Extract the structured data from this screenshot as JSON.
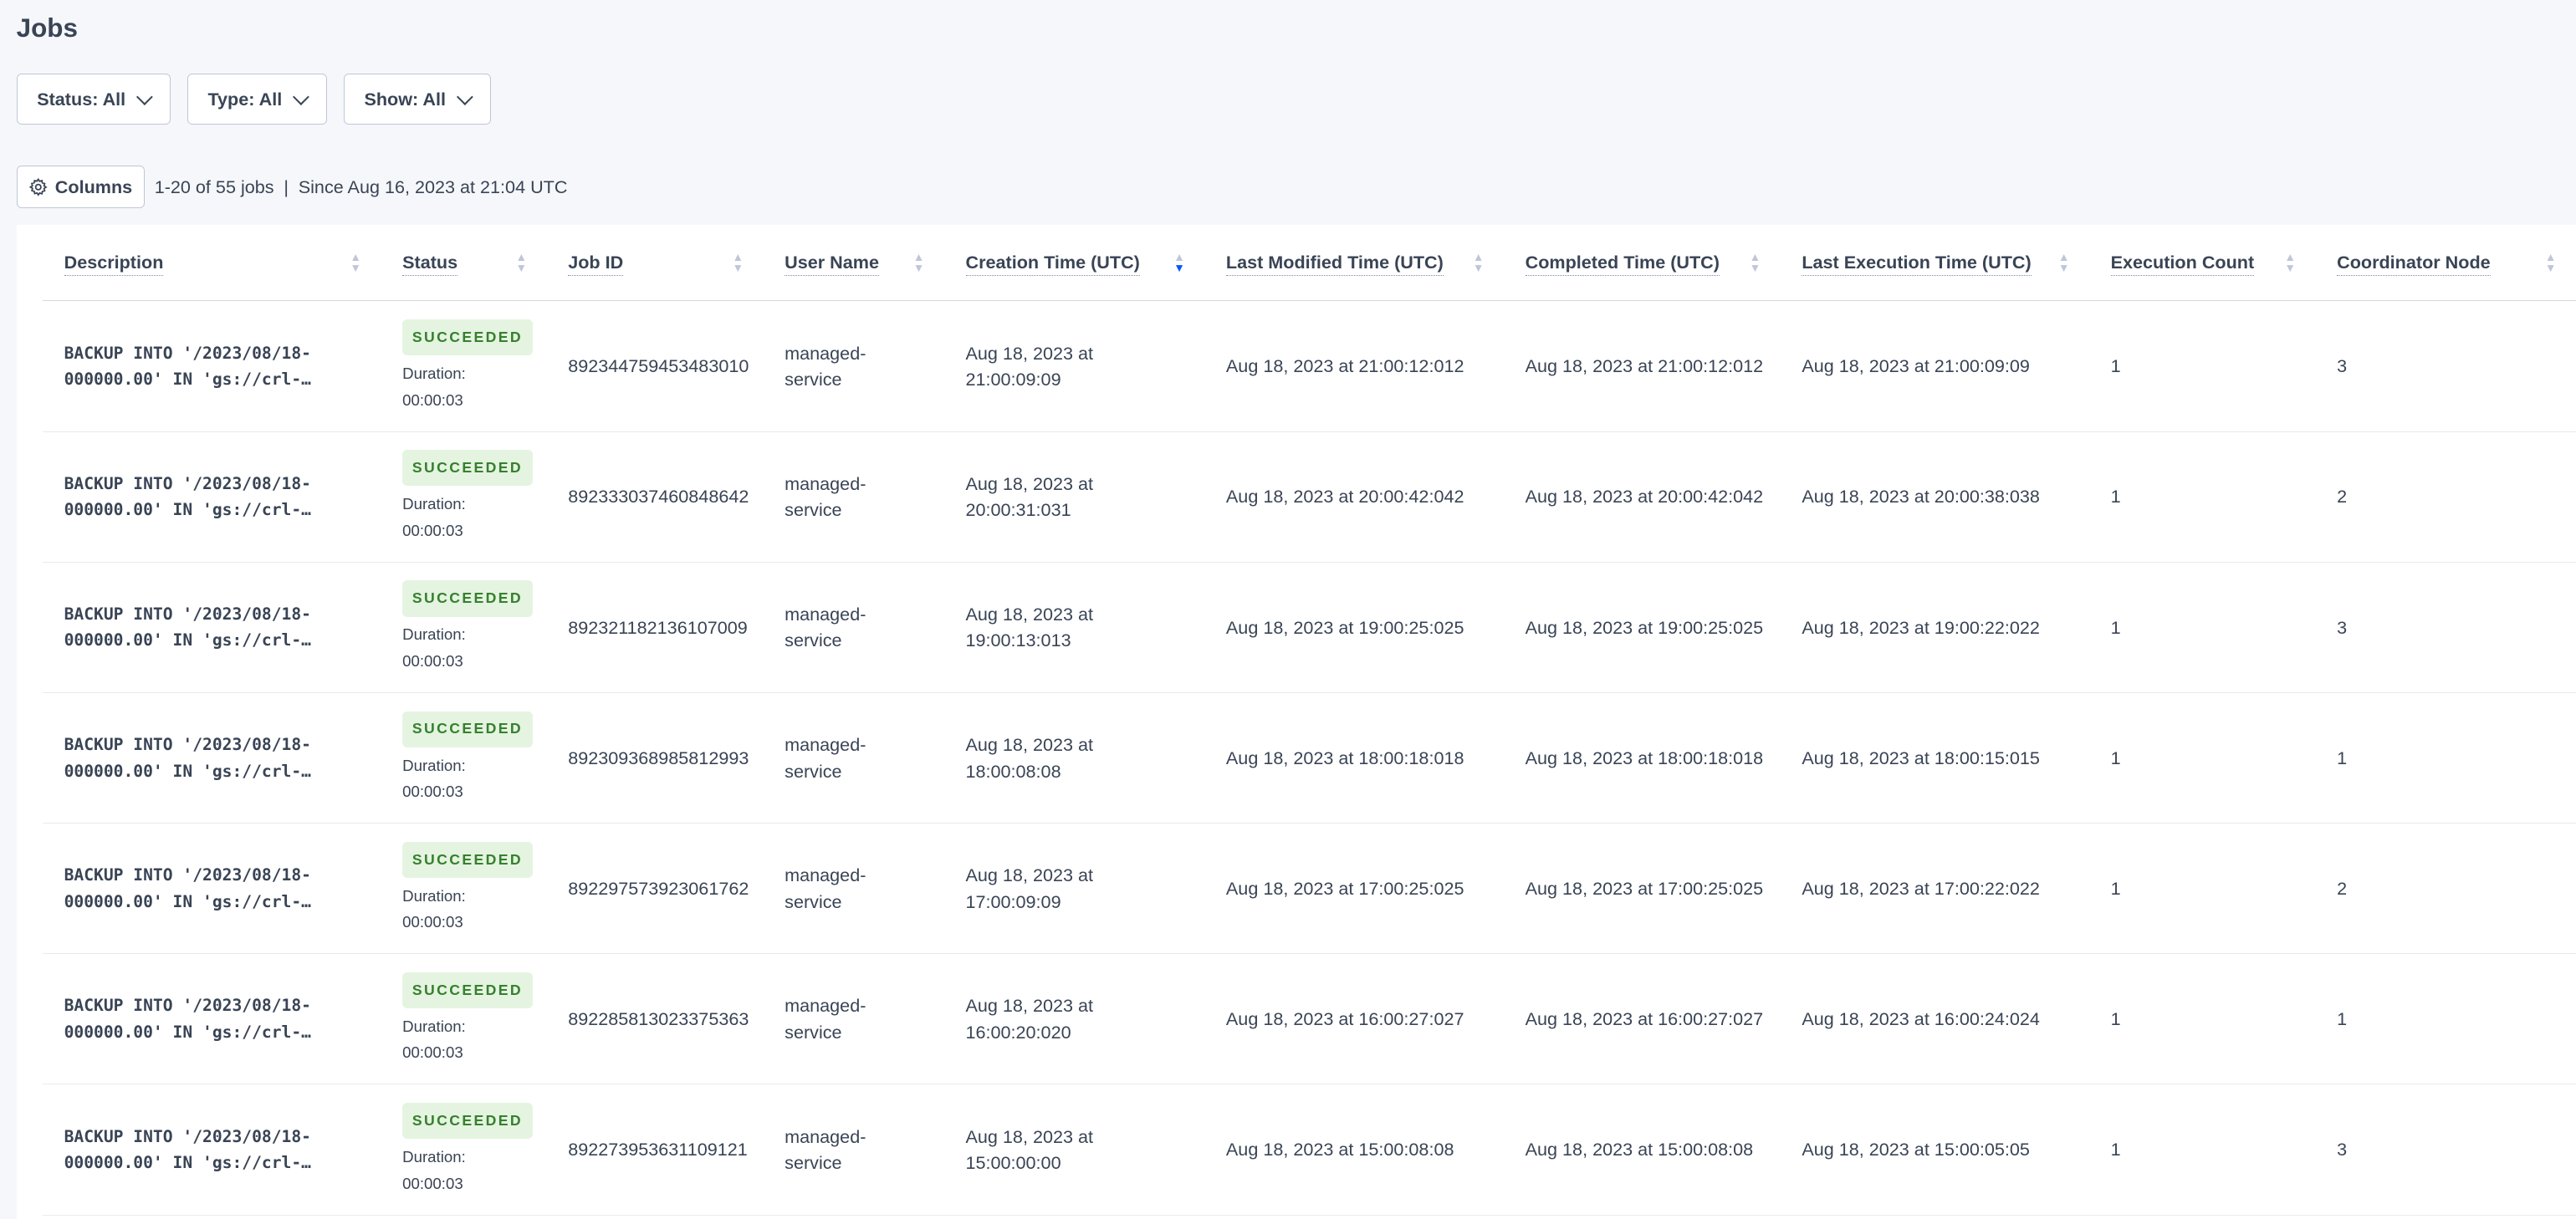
{
  "page": {
    "title": "Jobs"
  },
  "filters": [
    {
      "label": "Status: All"
    },
    {
      "label": "Type: All"
    },
    {
      "label": "Show: All"
    }
  ],
  "toolbar": {
    "columns_label": "Columns",
    "count": "1-20 of 55 jobs",
    "separator": "|",
    "since": "Since Aug 16, 2023 at 21:04 UTC"
  },
  "colors": {
    "success_bg": "#e4f4e0",
    "success_text": "#37802e",
    "sort_active": "#0055ff"
  },
  "table": {
    "columns": [
      {
        "label": "Description"
      },
      {
        "label": "Status"
      },
      {
        "label": "Job ID"
      },
      {
        "label": "User Name"
      },
      {
        "label": "Creation Time (UTC)",
        "sorted": "desc"
      },
      {
        "label": "Last Modified Time (UTC)"
      },
      {
        "label": "Completed Time (UTC)"
      },
      {
        "label": "Last Execution Time (UTC)"
      },
      {
        "label": "Execution Count"
      },
      {
        "label": "Coordinator Node"
      }
    ],
    "rows": [
      {
        "desc1": "BACKUP INTO '/2023/08/18-",
        "desc2": "000000.00' IN 'gs://crl-…",
        "status": "SUCCEEDED",
        "dur_label": "Duration:",
        "duration": "00:00:03",
        "job_id": "892344759453483010",
        "user1": "managed-",
        "user2": "service",
        "created1": "Aug 18, 2023 at",
        "created2": "21:00:09:09",
        "modified": "Aug 18, 2023 at 21:00:12:012",
        "completed": "Aug 18, 2023 at 21:00:12:012",
        "last_exec": "Aug 18, 2023 at 21:00:09:09",
        "exec_count": "1",
        "node": "3"
      },
      {
        "desc1": "BACKUP INTO '/2023/08/18-",
        "desc2": "000000.00' IN 'gs://crl-…",
        "status": "SUCCEEDED",
        "dur_label": "Duration:",
        "duration": "00:00:03",
        "job_id": "892333037460848642",
        "user1": "managed-",
        "user2": "service",
        "created1": "Aug 18, 2023 at",
        "created2": "20:00:31:031",
        "modified": "Aug 18, 2023 at 20:00:42:042",
        "completed": "Aug 18, 2023 at 20:00:42:042",
        "last_exec": "Aug 18, 2023 at 20:00:38:038",
        "exec_count": "1",
        "node": "2"
      },
      {
        "desc1": "BACKUP INTO '/2023/08/18-",
        "desc2": "000000.00' IN 'gs://crl-…",
        "status": "SUCCEEDED",
        "dur_label": "Duration:",
        "duration": "00:00:03",
        "job_id": "892321182136107009",
        "user1": "managed-",
        "user2": "service",
        "created1": "Aug 18, 2023 at",
        "created2": "19:00:13:013",
        "modified": "Aug 18, 2023 at 19:00:25:025",
        "completed": "Aug 18, 2023 at 19:00:25:025",
        "last_exec": "Aug 18, 2023 at 19:00:22:022",
        "exec_count": "1",
        "node": "3"
      },
      {
        "desc1": "BACKUP INTO '/2023/08/18-",
        "desc2": "000000.00' IN 'gs://crl-…",
        "status": "SUCCEEDED",
        "dur_label": "Duration:",
        "duration": "00:00:03",
        "job_id": "892309368985812993",
        "user1": "managed-",
        "user2": "service",
        "created1": "Aug 18, 2023 at",
        "created2": "18:00:08:08",
        "modified": "Aug 18, 2023 at 18:00:18:018",
        "completed": "Aug 18, 2023 at 18:00:18:018",
        "last_exec": "Aug 18, 2023 at 18:00:15:015",
        "exec_count": "1",
        "node": "1"
      },
      {
        "desc1": "BACKUP INTO '/2023/08/18-",
        "desc2": "000000.00' IN 'gs://crl-…",
        "status": "SUCCEEDED",
        "dur_label": "Duration:",
        "duration": "00:00:03",
        "job_id": "892297573923061762",
        "user1": "managed-",
        "user2": "service",
        "created1": "Aug 18, 2023 at",
        "created2": "17:00:09:09",
        "modified": "Aug 18, 2023 at 17:00:25:025",
        "completed": "Aug 18, 2023 at 17:00:25:025",
        "last_exec": "Aug 18, 2023 at 17:00:22:022",
        "exec_count": "1",
        "node": "2"
      },
      {
        "desc1": "BACKUP INTO '/2023/08/18-",
        "desc2": "000000.00' IN 'gs://crl-…",
        "status": "SUCCEEDED",
        "dur_label": "Duration:",
        "duration": "00:00:03",
        "job_id": "892285813023375363",
        "user1": "managed-",
        "user2": "service",
        "created1": "Aug 18, 2023 at",
        "created2": "16:00:20:020",
        "modified": "Aug 18, 2023 at 16:00:27:027",
        "completed": "Aug 18, 2023 at 16:00:27:027",
        "last_exec": "Aug 18, 2023 at 16:00:24:024",
        "exec_count": "1",
        "node": "1"
      },
      {
        "desc1": "BACKUP INTO '/2023/08/18-",
        "desc2": "000000.00' IN 'gs://crl-…",
        "status": "SUCCEEDED",
        "dur_label": "Duration:",
        "duration": "00:00:03",
        "job_id": "892273953631109121",
        "user1": "managed-",
        "user2": "service",
        "created1": "Aug 18, 2023 at",
        "created2": "15:00:00:00",
        "modified": "Aug 18, 2023 at 15:00:08:08",
        "completed": "Aug 18, 2023 at 15:00:08:08",
        "last_exec": "Aug 18, 2023 at 15:00:05:05",
        "exec_count": "1",
        "node": "3"
      }
    ]
  }
}
